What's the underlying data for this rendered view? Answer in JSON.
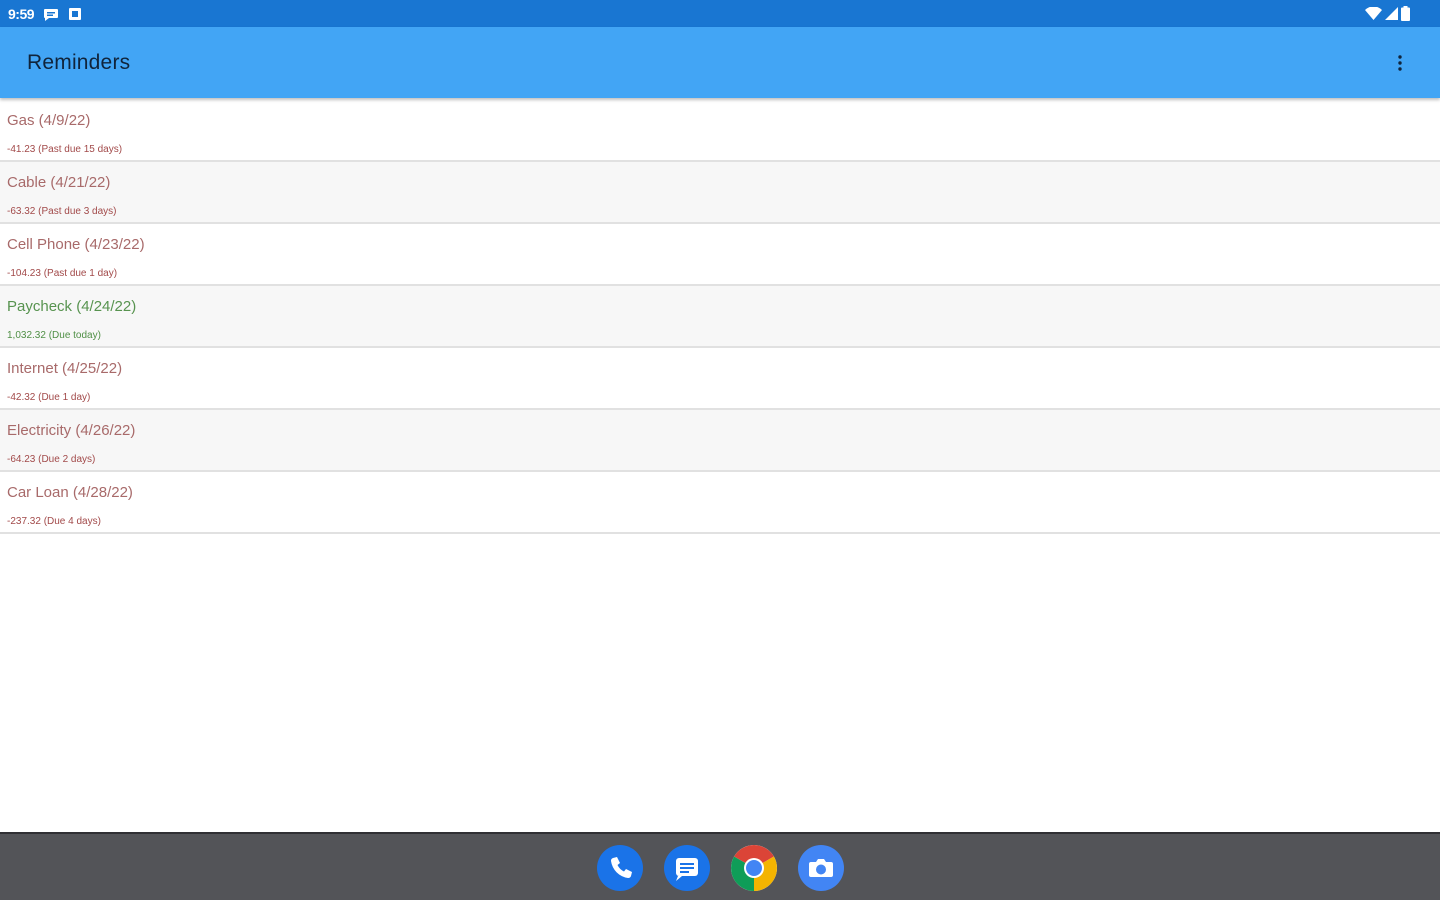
{
  "status_bar": {
    "time": "9:59"
  },
  "app_bar": {
    "title": "Reminders",
    "overflow_icon": "more-vert-icon"
  },
  "reminders": [
    {
      "title": "Gas (4/9/22)",
      "detail": "-41.23 (Past due 15 days)",
      "kind": "expense"
    },
    {
      "title": "Cable (4/21/22)",
      "detail": "-63.32 (Past due 3 days)",
      "kind": "expense"
    },
    {
      "title": "Cell Phone (4/23/22)",
      "detail": "-104.23 (Past due 1 day)",
      "kind": "expense"
    },
    {
      "title": "Paycheck (4/24/22)",
      "detail": "1,032.32 (Due today)",
      "kind": "income"
    },
    {
      "title": "Internet (4/25/22)",
      "detail": "-42.32 (Due 1 day)",
      "kind": "expense"
    },
    {
      "title": "Electricity (4/26/22)",
      "detail": "-64.23 (Due 2 days)",
      "kind": "expense"
    },
    {
      "title": "Car Loan (4/28/22)",
      "detail": "-237.32 (Due 4 days)",
      "kind": "expense"
    }
  ],
  "colors": {
    "status_bar": "#1976d2",
    "app_bar": "#42a5f5",
    "expense_text": "#a24a4a",
    "income_text": "#4f8f45",
    "taskbar": "#535458"
  },
  "dock": [
    {
      "name": "phone-app-icon"
    },
    {
      "name": "messages-app-icon"
    },
    {
      "name": "chrome-app-icon"
    },
    {
      "name": "camera-app-icon"
    }
  ]
}
